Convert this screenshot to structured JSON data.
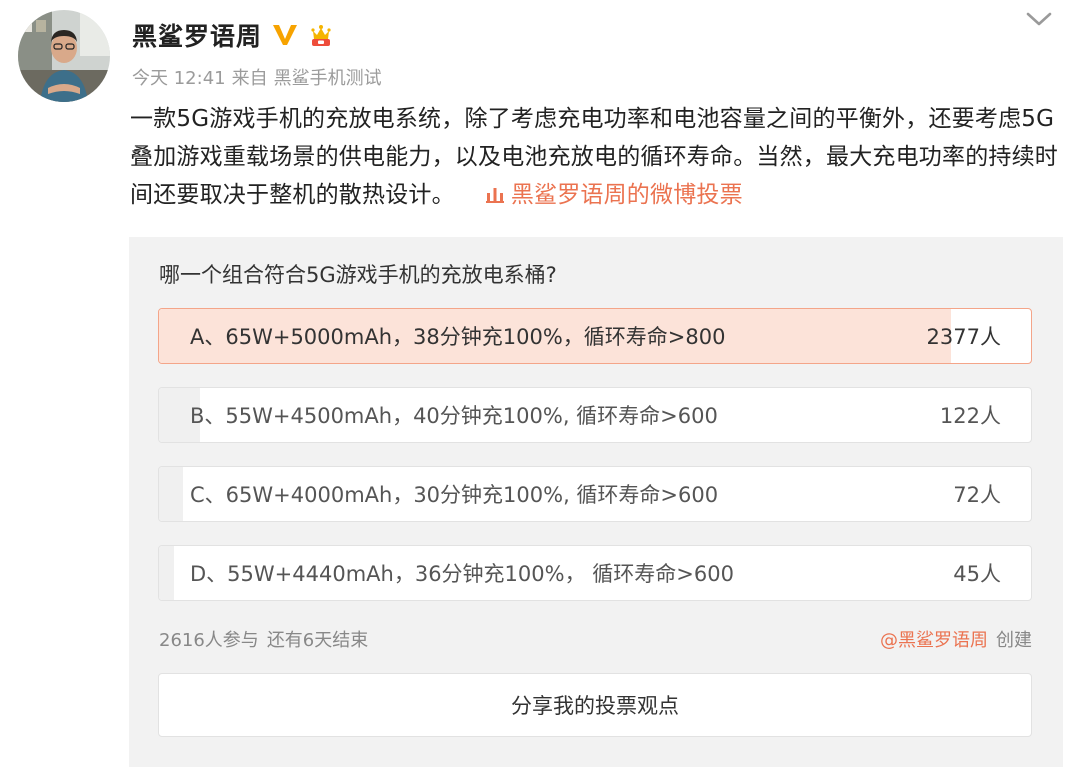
{
  "header": {
    "username": "黑鲨罗语周",
    "time": "今天 12:41",
    "source_prefix": "来自",
    "source": "黑鲨手机测试"
  },
  "post": {
    "text": "一款5G游戏手机的充放电系统，除了考虑充电功率和电池容量之间的平衡外，还要考虑5G叠加游戏重载场景的供电能力，以及电池充放电的循环寿命。当然，最大充电功率的持续时间还要取决于整机的散热设计。",
    "poll_link": "黑鲨罗语周的微博投票"
  },
  "poll": {
    "question": "哪一个组合符合5G游戏手机的充放电系桶?",
    "options": [
      {
        "label": "A、65W+5000mAh，38分钟充100%，循环寿命>800",
        "count": "2377人",
        "share": 0.908
      },
      {
        "label": "B、55W+4500mAh，40分钟充100%, 循环寿命>600",
        "count": "122人",
        "share": 0.047
      },
      {
        "label": "C、65W+4000mAh，30分钟充100%, 循环寿命>600",
        "count": "72人",
        "share": 0.028
      },
      {
        "label": "D、55W+4440mAh，36分钟充100%， 循环寿命>600",
        "count": "45人",
        "share": 0.017
      }
    ],
    "selected_index": 0,
    "participants": "2616人参与",
    "remaining": "还有6天结束",
    "creator": "@黑鲨罗语周",
    "created_label": "创建",
    "share_button": "分享我的投票观点"
  },
  "colors": {
    "accent": "#eb7350",
    "selected_fill": "#fce3d9",
    "selected_border": "#f4a589",
    "bar_fill": "#f0f0f0",
    "card_bg": "#f2f2f2",
    "verified_v": "#f7a300"
  },
  "icons": {
    "verified": "verified-v-icon",
    "crown": "crown-badge-icon",
    "more": "chevron-down-icon",
    "poll": "poll-icon"
  }
}
